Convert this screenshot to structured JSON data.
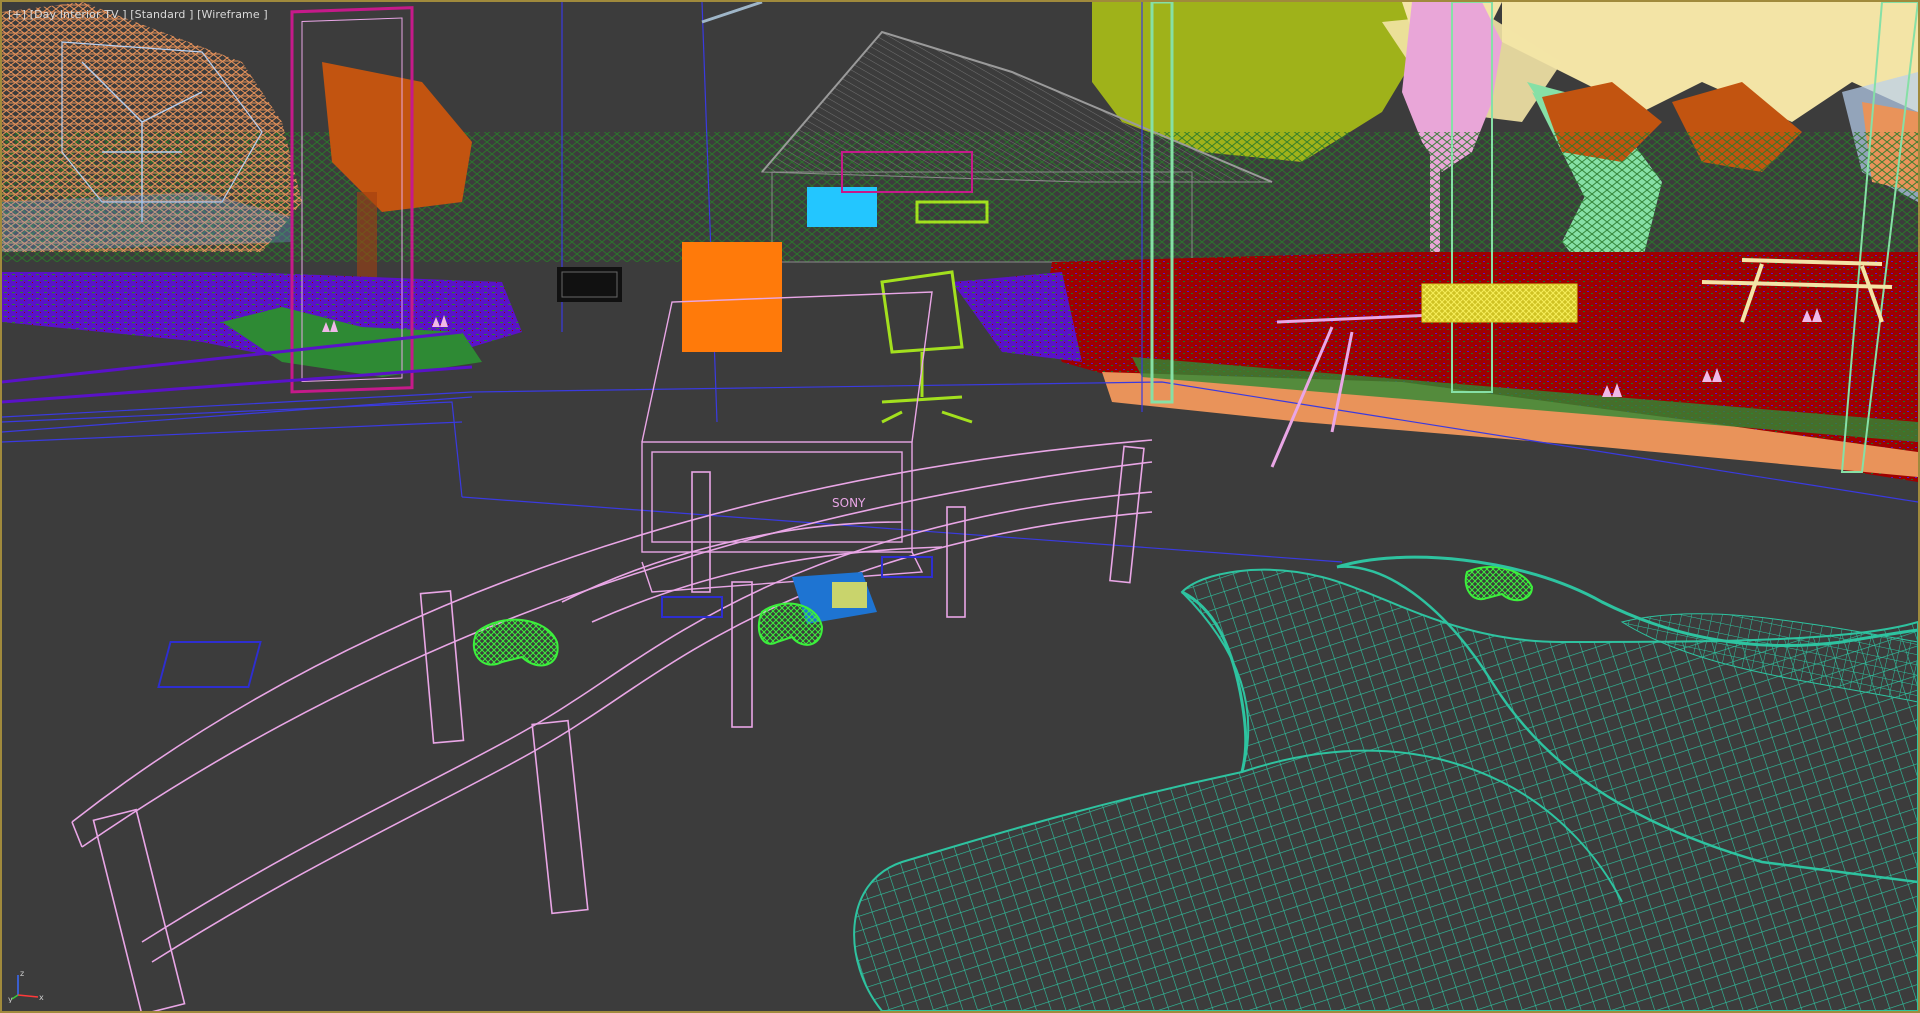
{
  "viewport": {
    "label": "[+] [Day Interior TV ] [Standard ] [Wireframe ]",
    "shading_mode": "Wireframe",
    "camera": "Day Interior TV",
    "render_preset": "Standard",
    "border_color": "#a08a3c",
    "background_color": "#3c3c3c"
  },
  "scene_objects": [
    {
      "name": "glass-tv-stand",
      "color": "#e9a6e6"
    },
    {
      "name": "curved-sofa",
      "color": "#2ec3a0"
    },
    {
      "name": "game-controller",
      "color": "#3cf03c"
    },
    {
      "name": "game-console",
      "color": "#1e74d2"
    },
    {
      "name": "sony-tv",
      "color": "#e9a6e6"
    },
    {
      "name": "office-chair",
      "color": "#a3e01e"
    },
    {
      "name": "outdoor-lawn",
      "color": "#9e0000"
    },
    {
      "name": "tree-canopy",
      "color": "#9fb21a"
    },
    {
      "name": "picnic-bench",
      "color": "#f3e4a6"
    },
    {
      "name": "yellow-bench",
      "color": "#f0e03c"
    },
    {
      "name": "side-table",
      "color": "#e9a6e6"
    }
  ],
  "axis_gizmo": {
    "x": "x",
    "y": "y",
    "z": "z"
  }
}
